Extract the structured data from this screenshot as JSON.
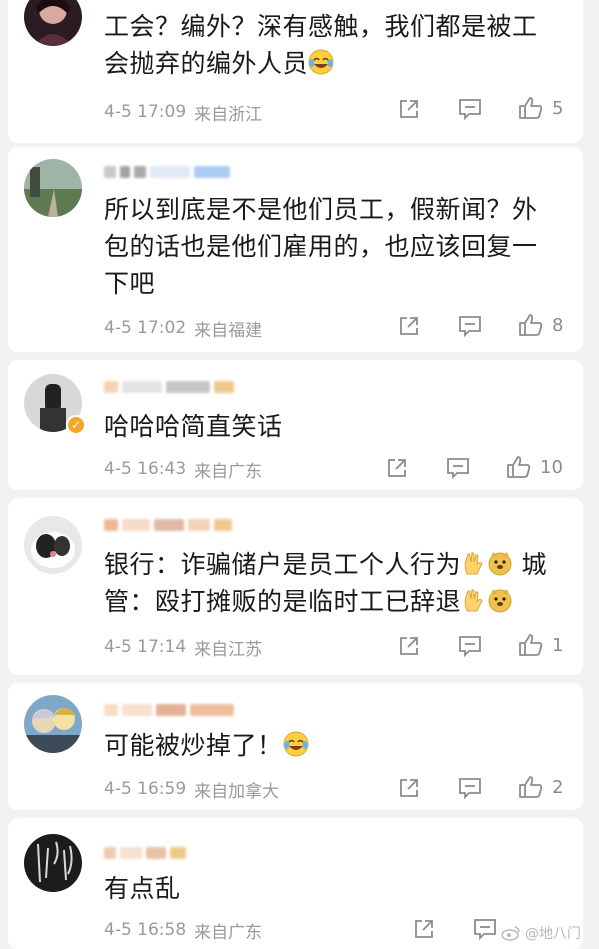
{
  "comments": [
    {
      "text": "工会？编外？深有感触，我们都是被工会抛弃的编外人员",
      "emoji_after_text": "laughing-crying-emoji",
      "time": "4-5 17:09",
      "location": "来自浙江",
      "likes": "5"
    },
    {
      "text": "所以到底是不是他们员工，假新闻？外包的话也是他们雇用的，也应该回复一下吧",
      "time": "4-5 17:02",
      "location": "来自福建",
      "likes": "8"
    },
    {
      "text": "哈哈哈简直笑话",
      "time": "4-5 16:43",
      "location": "来自广东",
      "likes": "10",
      "verified": true
    },
    {
      "text_part1": "银行：诈骗储户是员工个人行为",
      "text_part2": " 城管：殴打摊贩的是临时工已辞退",
      "emojis": [
        "ok-hand-emoji",
        "doge-emoji"
      ],
      "time": "4-5 17:14",
      "location": "来自江苏",
      "likes": "1"
    },
    {
      "text": "可能被炒掉了！",
      "emoji_after_text": "laughing-crying-emoji",
      "time": "4-5 16:59",
      "location": "来自加拿大",
      "likes": "2"
    },
    {
      "text": "有点乱",
      "time": "4-5 16:58",
      "location": "来自广东"
    }
  ],
  "watermark": {
    "text": "@地八门"
  },
  "colors": {
    "background": "#f2f2f2",
    "card": "#ffffff",
    "meta_text": "#9a9a9a",
    "icon": "#8c8c8c",
    "verified_badge": "#f5a623"
  }
}
